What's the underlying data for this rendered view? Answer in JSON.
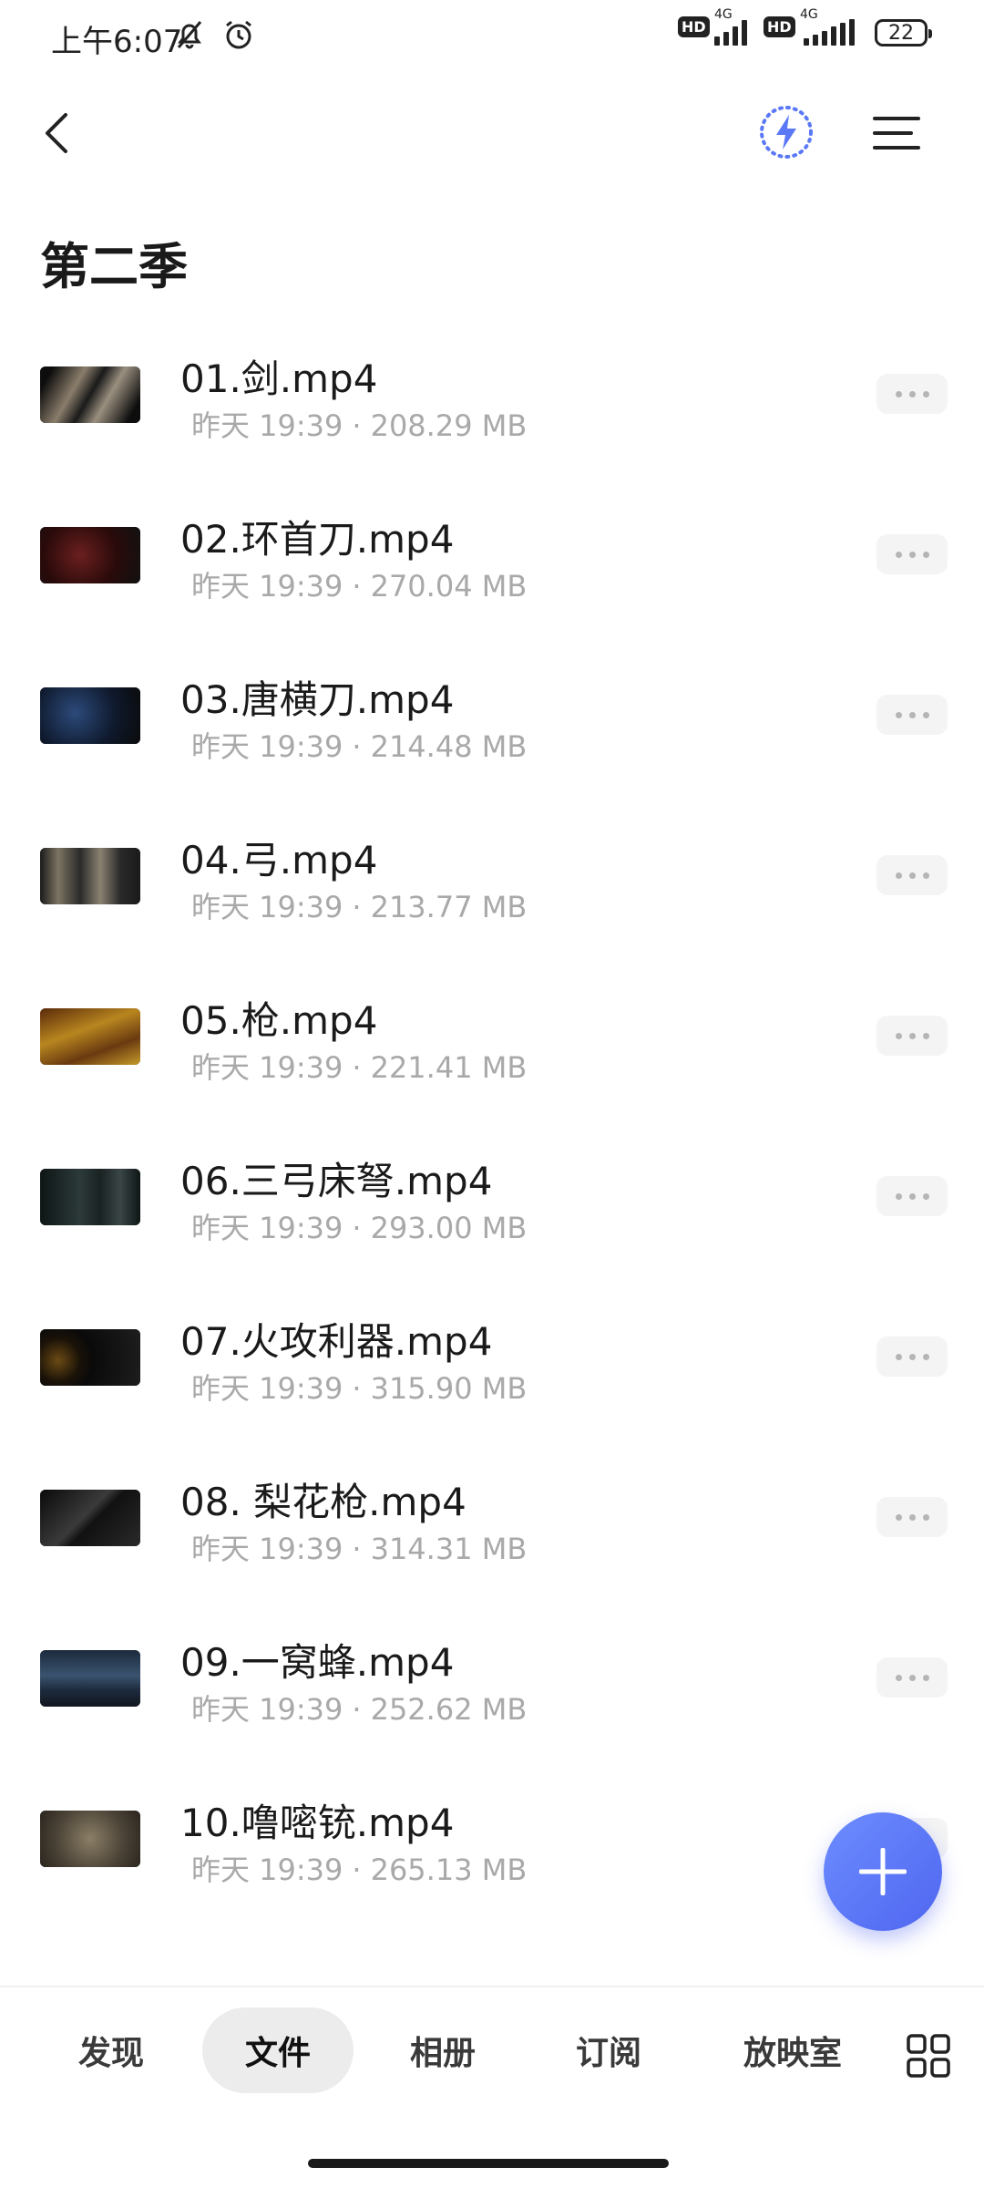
{
  "status_bar": {
    "time": "上午6:07",
    "hd_label": "HD",
    "network_label": "4G",
    "battery": "22"
  },
  "header": {
    "title": "第二季"
  },
  "files": [
    {
      "name": "01.剑.mp4",
      "time": "昨天 19:39",
      "size": "208.29 MB"
    },
    {
      "name": "02.环首刀.mp4",
      "time": "昨天 19:39",
      "size": "270.04 MB"
    },
    {
      "name": "03.唐横刀.mp4",
      "time": "昨天 19:39",
      "size": "214.48 MB"
    },
    {
      "name": "04.弓.mp4",
      "time": "昨天 19:39",
      "size": "213.77 MB"
    },
    {
      "name": "05.枪.mp4",
      "time": "昨天 19:39",
      "size": "221.41 MB"
    },
    {
      "name": "06.三弓床弩.mp4",
      "time": "昨天 19:39",
      "size": "293.00 MB"
    },
    {
      "name": "07.火攻利器.mp4",
      "time": "昨天 19:39",
      "size": "315.90 MB"
    },
    {
      "name": "08. 梨花枪.mp4",
      "time": "昨天 19:39",
      "size": "314.31 MB"
    },
    {
      "name": "09.一窝蜂.mp4",
      "time": "昨天 19:39",
      "size": "252.62 MB"
    },
    {
      "name": "10.噜嘧铳.mp4",
      "time": "昨天 19:39",
      "size": "265.13 MB"
    }
  ],
  "bottom_nav": {
    "tabs": [
      {
        "label": "发现"
      },
      {
        "label": "文件"
      },
      {
        "label": "相册"
      },
      {
        "label": "订阅"
      },
      {
        "label": "放映室"
      }
    ],
    "active": "文件"
  },
  "colors": {
    "accent": "#5b78f6",
    "meta_text": "#a9a9a9",
    "more_bg": "#f4f4f4"
  },
  "icons": [
    "back-arrow-icon",
    "speed-boost-icon",
    "menu-icon",
    "more-icon",
    "plus-icon",
    "grid-icon",
    "mute-icon",
    "alarm-icon",
    "signal-icon",
    "battery-icon"
  ]
}
